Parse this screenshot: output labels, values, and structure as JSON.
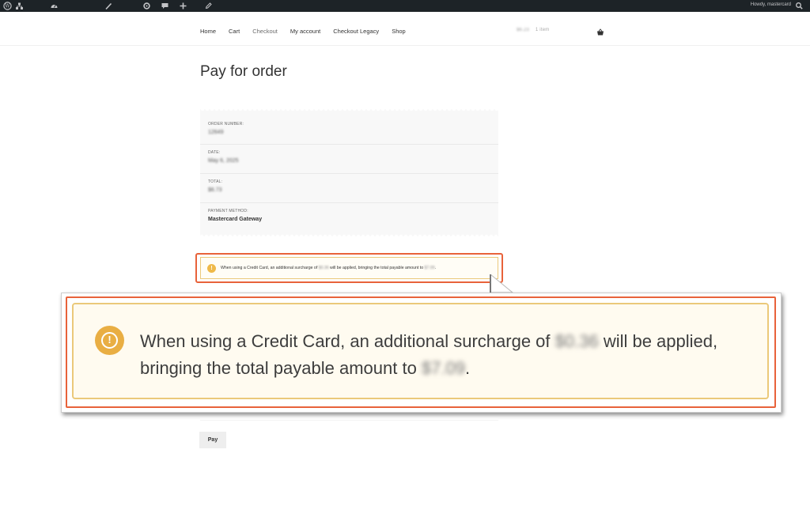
{
  "adminbar": {
    "howdy": "Howdy, mastercard",
    "icons": [
      "wordpress-icon",
      "site-network-icon",
      "dashboard-icon",
      "customize-icon",
      "updates-icon",
      "comments-icon",
      "new-icon",
      "edit-icon",
      "search-icon"
    ]
  },
  "nav": {
    "items": [
      "Home",
      "Cart",
      "Checkout",
      "My account",
      "Checkout Legacy",
      "Shop"
    ]
  },
  "cart": {
    "amount": "$6.23",
    "count": "1 item"
  },
  "page": {
    "title": "Pay for order"
  },
  "order": {
    "number_label": "ORDER NUMBER:",
    "number_value": "12649",
    "date_label": "DATE:",
    "date_value": "May 6, 2025",
    "total_label": "TOTAL:",
    "total_value": "$6.73",
    "method_label": "PAYMENT METHOD:",
    "method_value": "Mastercard Gateway"
  },
  "notice": {
    "text_before": "When using a Credit Card, an additional surcharge of ",
    "surcharge": "$0.36",
    "text_middle": " will be applied, bringing the total payable amount to ",
    "total": "$7.09",
    "text_after": "."
  },
  "colors": {
    "adminbar_bg": "#1d2327",
    "highlight": "#e8623a",
    "notice_border": "#ebc97a",
    "notice_icon": "#e9ae43"
  },
  "pay_button": "Pay"
}
